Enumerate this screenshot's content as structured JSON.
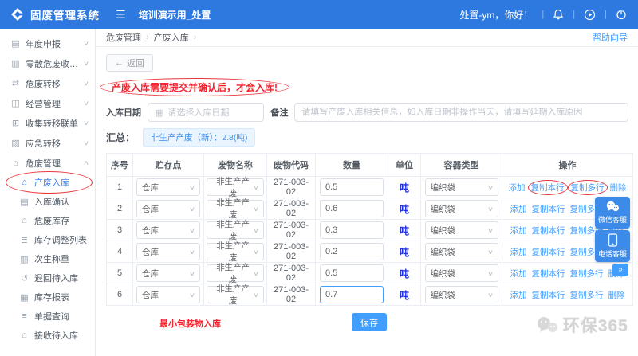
{
  "topbar": {
    "brand": "固废管理系统",
    "tab": "培训演示用_处置",
    "greeting": "处置-ym，你好！"
  },
  "icons": {
    "hamburger": "☰",
    "chevron_down": "∨",
    "chevron_up": "∧",
    "select_chevron": "∨",
    "back_arrow": "←",
    "calendar": "▦",
    "breadcrumb_sep": "›",
    "divider": "|",
    "collapse_chevrons": "»"
  },
  "sidebar": {
    "items": [
      {
        "label": "年度申报",
        "icon_name": "annual-declaration-icon",
        "icon_glyph": "▤",
        "state": "collapsed"
      },
      {
        "label": "零散危废收集填报",
        "icon_name": "scattered-collection-icon",
        "icon_glyph": "▥",
        "state": "collapsed"
      },
      {
        "label": "危废转移",
        "icon_name": "waste-transfer-icon",
        "icon_glyph": "⇄",
        "state": "collapsed"
      },
      {
        "label": "经营管理",
        "icon_name": "operation-management-icon",
        "icon_glyph": "◫",
        "state": "collapsed"
      },
      {
        "label": "收集转移联单",
        "icon_name": "transfer-manifest-icon",
        "icon_glyph": "⊞",
        "state": "collapsed"
      },
      {
        "label": "应急转移",
        "icon_name": "emergency-transfer-icon",
        "icon_glyph": "▨",
        "state": "collapsed"
      },
      {
        "label": "危废管理",
        "icon_name": "waste-management-icon",
        "icon_glyph": "⌂",
        "state": "expanded"
      }
    ],
    "submenu": [
      {
        "label": "产废入库",
        "icon_name": "warehouse-in-icon",
        "icon_glyph": "⌂",
        "active": true
      },
      {
        "label": "入库确认",
        "icon_name": "inbound-confirm-icon",
        "icon_glyph": "▤",
        "active": false
      },
      {
        "label": "危废库存",
        "icon_name": "waste-stock-icon",
        "icon_glyph": "⌂",
        "active": false
      },
      {
        "label": "库存调整列表",
        "icon_name": "stock-adjust-list-icon",
        "icon_glyph": "≣",
        "active": false
      },
      {
        "label": "次生称重",
        "icon_name": "secondary-weighing-icon",
        "icon_glyph": "▥",
        "active": false
      },
      {
        "label": "退回待入库",
        "icon_name": "return-pending-icon",
        "icon_glyph": "↺",
        "active": false
      },
      {
        "label": "库存报表",
        "icon_name": "stock-report-icon",
        "icon_glyph": "▦",
        "active": false
      },
      {
        "label": "单据查询",
        "icon_name": "document-query-icon",
        "icon_glyph": "≡",
        "active": false
      },
      {
        "label": "接收待入库",
        "icon_name": "receive-pending-icon",
        "icon_glyph": "⌂",
        "active": false
      }
    ]
  },
  "breadcrumb": {
    "level1": "危废管理",
    "level2": "产废入库",
    "help_link": "帮助向导"
  },
  "toolbar": {
    "back_label": "返回"
  },
  "warning_text": "产废入库需要提交并确认后，才会入库!",
  "form": {
    "date_label": "入库日期",
    "date_placeholder": "请选择入库日期",
    "remark_label": "备注",
    "remark_placeholder": "请填写产废入库相关信息，如入库日期非操作当天，请填写延期入库原因"
  },
  "summary": {
    "label": "汇总：",
    "badge": "非生产产废（新）：2.8(吨)"
  },
  "table": {
    "headers": [
      "序号",
      "贮存点",
      "废物名称",
      "废物代码",
      "数量",
      "单位",
      "容器类型",
      "操作"
    ],
    "action_labels": [
      "添加",
      "复制本行",
      "复制多行",
      "删除"
    ],
    "rows": [
      {
        "seq": "1",
        "storage": "仓库",
        "waste_name": "非生产产废",
        "waste_code": "271-003-02",
        "quantity": "0.5",
        "unit": "吨",
        "container": "编织袋",
        "circled_actions": true,
        "focused": false
      },
      {
        "seq": "2",
        "storage": "仓库",
        "waste_name": "非生产产废",
        "waste_code": "271-003-02",
        "quantity": "0.6",
        "unit": "吨",
        "container": "编织袋",
        "circled_actions": false,
        "focused": false
      },
      {
        "seq": "3",
        "storage": "仓库",
        "waste_name": "非生产产废",
        "waste_code": "271-003-02",
        "quantity": "0.3",
        "unit": "吨",
        "container": "编织袋",
        "circled_actions": false,
        "focused": false
      },
      {
        "seq": "4",
        "storage": "仓库",
        "waste_name": "非生产产废",
        "waste_code": "271-003-02",
        "quantity": "0.2",
        "unit": "吨",
        "container": "编织袋",
        "circled_actions": false,
        "focused": false
      },
      {
        "seq": "5",
        "storage": "仓库",
        "waste_name": "非生产产废",
        "waste_code": "271-003-02",
        "quantity": "0.5",
        "unit": "吨",
        "container": "编织袋",
        "circled_actions": false,
        "focused": false
      },
      {
        "seq": "6",
        "storage": "仓库",
        "waste_name": "非生产产废",
        "waste_code": "271-003-02",
        "quantity": "0.7",
        "unit": "吨",
        "container": "编织袋",
        "circled_actions": false,
        "focused": true
      }
    ]
  },
  "save_label": "保存",
  "footnote": "最小包装物入库",
  "floating": {
    "wechat_label": "微信客服",
    "phone_label": "电话客服"
  },
  "watermark": "环保365",
  "colors": {
    "topbar_blue": "#2e79df",
    "accent_blue": "#409eff",
    "active_menu_blue": "#3d7ce8",
    "unit_blue": "#2335d6",
    "warning_red": "#f5222d",
    "circle_red": "#e8383d",
    "badge_bg": "#e9f4ff"
  }
}
